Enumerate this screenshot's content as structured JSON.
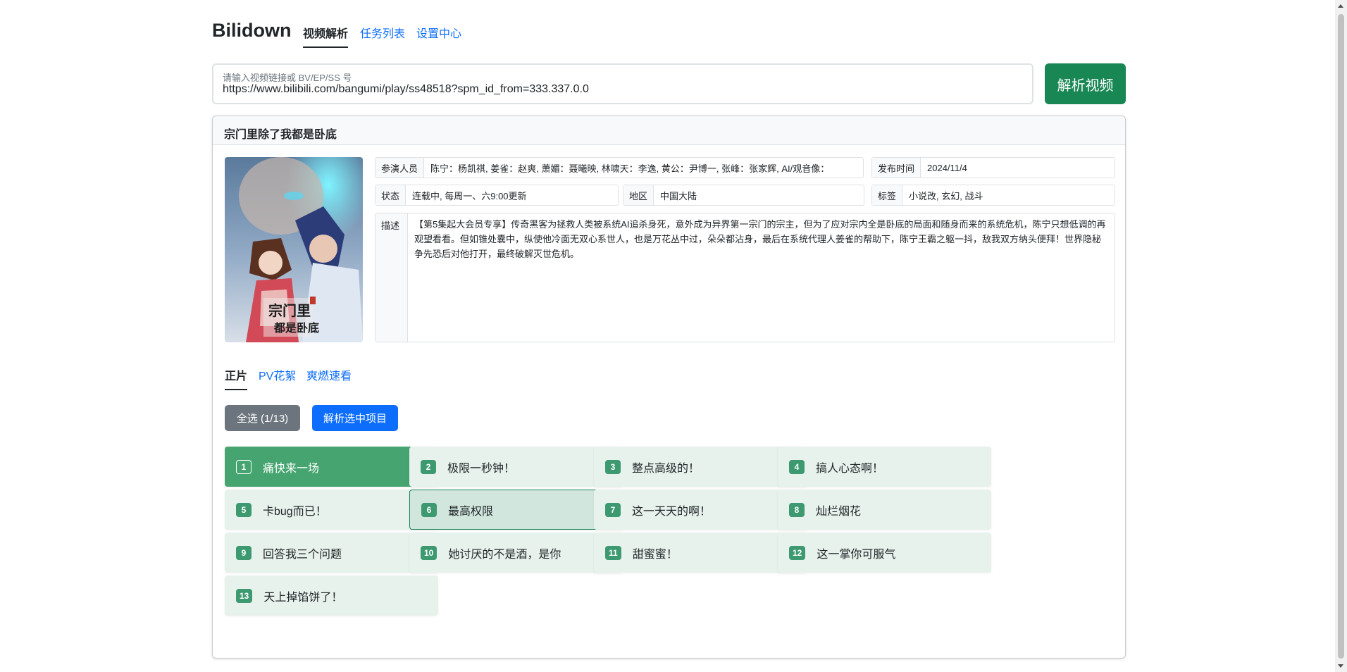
{
  "nav": {
    "brand": "Bilidown",
    "tabs": [
      {
        "label": "视频解析"
      },
      {
        "label": "任务列表"
      },
      {
        "label": "设置中心"
      }
    ]
  },
  "search": {
    "placeholder": "请输入视频链接或 BV/EP/SS 号",
    "value": "https://www.bilibili.com/bangumi/play/ss48518?spm_id_from=333.337.0.0",
    "button_label": "解析视频"
  },
  "card": {
    "title": "宗门里除了我都是卧底",
    "info": {
      "cast_label": "参演人员",
      "cast_value": "陈宁：杨凯祺, 姜雀：赵爽, 萧媚：聂曦映, 林啸天：李逸, 黄公：尹博一, 张峰：张家辉, AI/观音像：",
      "date_label": "发布时间",
      "date_value": "2024/11/4",
      "status_label": "状态",
      "status_value": "连载中, 每周一、六9:00更新",
      "region_label": "地区",
      "region_value": "中国大陆",
      "tags_label": "标签",
      "tags_value": "小说改, 玄幻, 战斗",
      "desc_label": "描述",
      "desc_value": "【第5集起大会员专享】传奇黑客为拯救人类被系统AI追杀身死，意外成为异界第一宗门的宗主，但为了应对宗内全是卧底的局面和随身而来的系统危机，陈宁只想低调的再观望看看。但如锥处囊中，纵使他冷面无双心系世人，也是万花丛中过，朵朵都沾身，最后在系统代理人姜雀的帮助下，陈宁王霸之躯一抖，敌我双方纳头便拜！世界隐秘争先恐后对他打开，最终破解灭世危机。"
    },
    "poster_text": "宗门里都是卧底",
    "sub_tabs": [
      {
        "label": "正片"
      },
      {
        "label": "PV花絮"
      },
      {
        "label": "爽燃速看"
      }
    ],
    "select_all_label": "全选 (1/13)",
    "parse_selected_label": "解析选中项目",
    "episodes": [
      {
        "num": "1",
        "title": "痛快来一场"
      },
      {
        "num": "2",
        "title": "极限一秒钟！"
      },
      {
        "num": "3",
        "title": "整点高级的！"
      },
      {
        "num": "4",
        "title": "搞人心态啊！"
      },
      {
        "num": "5",
        "title": "卡bug而已！"
      },
      {
        "num": "6",
        "title": "最高权限"
      },
      {
        "num": "7",
        "title": "这一天天的啊！"
      },
      {
        "num": "8",
        "title": "灿烂烟花"
      },
      {
        "num": "9",
        "title": "回答我三个问题"
      },
      {
        "num": "10",
        "title": "她讨厌的不是酒，是你"
      },
      {
        "num": "11",
        "title": "甜蜜蜜！"
      },
      {
        "num": "12",
        "title": "这一掌你可服气"
      },
      {
        "num": "13",
        "title": "天上掉馅饼了！"
      }
    ]
  },
  "colors": {
    "primary": "#0d6efd",
    "success": "#198754",
    "episode_bg": "#e8f2ec",
    "episode_selected": "#45a470"
  }
}
